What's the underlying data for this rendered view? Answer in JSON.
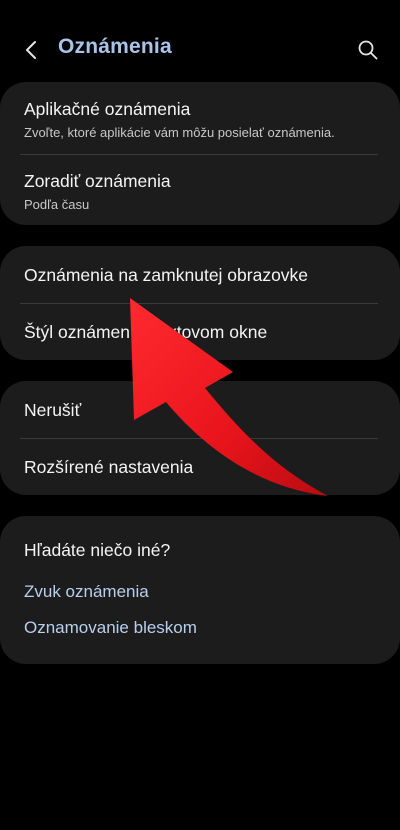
{
  "header": {
    "title": "Oznámenia",
    "back_icon": "chevron-left-icon",
    "search_icon": "search-icon"
  },
  "group1": {
    "app_notifications": {
      "title": "Aplikačné oznámenia",
      "subtitle": "Zvoľte, ktoré aplikácie vám môžu posielať oznámenia."
    },
    "sort_notifications": {
      "title": "Zoradiť oznámenia",
      "subtitle": "Podľa času"
    }
  },
  "group2": {
    "lock_screen": "Oznámenia na zamknutej obrazovke",
    "popup_style": "Štýl oznámení v textovom okne"
  },
  "group3": {
    "dnd": "Nerušiť",
    "advanced": "Rozšírené nastavenia"
  },
  "suggestions": {
    "heading": "Hľadáte niečo iné?",
    "links": [
      "Zvuk oznámenia",
      "Oznamovanie bleskom"
    ]
  },
  "colors": {
    "background": "#000000",
    "card": "#1c1c1c",
    "title_accent": "#a9c4ea",
    "link": "#b9cfee",
    "annotation_arrow": "#e8141b"
  }
}
